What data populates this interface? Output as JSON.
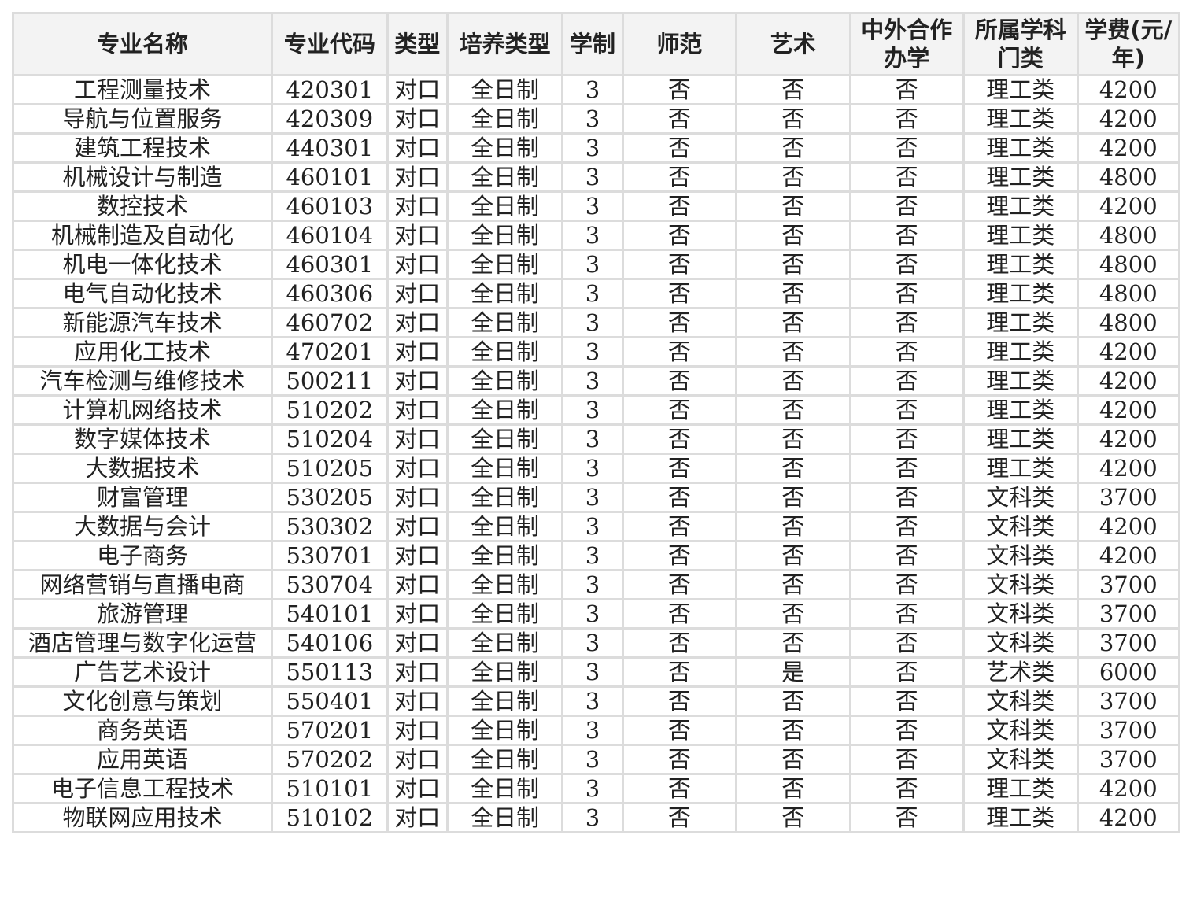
{
  "table": {
    "headers": [
      "专业名称",
      "专业代码",
      "类型",
      "培养类型",
      "学制",
      "师范",
      "艺术",
      "中外合作办学",
      "所属学科门类",
      "学费(元/年)"
    ],
    "rows": [
      [
        "工程测量技术",
        "420301",
        "对口",
        "全日制",
        "3",
        "否",
        "否",
        "否",
        "理工类",
        "4200"
      ],
      [
        "导航与位置服务",
        "420309",
        "对口",
        "全日制",
        "3",
        "否",
        "否",
        "否",
        "理工类",
        "4200"
      ],
      [
        "建筑工程技术",
        "440301",
        "对口",
        "全日制",
        "3",
        "否",
        "否",
        "否",
        "理工类",
        "4200"
      ],
      [
        "机械设计与制造",
        "460101",
        "对口",
        "全日制",
        "3",
        "否",
        "否",
        "否",
        "理工类",
        "4800"
      ],
      [
        "数控技术",
        "460103",
        "对口",
        "全日制",
        "3",
        "否",
        "否",
        "否",
        "理工类",
        "4200"
      ],
      [
        "机械制造及自动化",
        "460104",
        "对口",
        "全日制",
        "3",
        "否",
        "否",
        "否",
        "理工类",
        "4800"
      ],
      [
        "机电一体化技术",
        "460301",
        "对口",
        "全日制",
        "3",
        "否",
        "否",
        "否",
        "理工类",
        "4800"
      ],
      [
        "电气自动化技术",
        "460306",
        "对口",
        "全日制",
        "3",
        "否",
        "否",
        "否",
        "理工类",
        "4800"
      ],
      [
        "新能源汽车技术",
        "460702",
        "对口",
        "全日制",
        "3",
        "否",
        "否",
        "否",
        "理工类",
        "4800"
      ],
      [
        "应用化工技术",
        "470201",
        "对口",
        "全日制",
        "3",
        "否",
        "否",
        "否",
        "理工类",
        "4200"
      ],
      [
        "汽车检测与维修技术",
        "500211",
        "对口",
        "全日制",
        "3",
        "否",
        "否",
        "否",
        "理工类",
        "4200"
      ],
      [
        "计算机网络技术",
        "510202",
        "对口",
        "全日制",
        "3",
        "否",
        "否",
        "否",
        "理工类",
        "4200"
      ],
      [
        "数字媒体技术",
        "510204",
        "对口",
        "全日制",
        "3",
        "否",
        "否",
        "否",
        "理工类",
        "4200"
      ],
      [
        "大数据技术",
        "510205",
        "对口",
        "全日制",
        "3",
        "否",
        "否",
        "否",
        "理工类",
        "4200"
      ],
      [
        "财富管理",
        "530205",
        "对口",
        "全日制",
        "3",
        "否",
        "否",
        "否",
        "文科类",
        "3700"
      ],
      [
        "大数据与会计",
        "530302",
        "对口",
        "全日制",
        "3",
        "否",
        "否",
        "否",
        "文科类",
        "4200"
      ],
      [
        "电子商务",
        "530701",
        "对口",
        "全日制",
        "3",
        "否",
        "否",
        "否",
        "文科类",
        "4200"
      ],
      [
        "网络营销与直播电商",
        "530704",
        "对口",
        "全日制",
        "3",
        "否",
        "否",
        "否",
        "文科类",
        "3700"
      ],
      [
        "旅游管理",
        "540101",
        "对口",
        "全日制",
        "3",
        "否",
        "否",
        "否",
        "文科类",
        "3700"
      ],
      [
        "酒店管理与数字化运营",
        "540106",
        "对口",
        "全日制",
        "3",
        "否",
        "否",
        "否",
        "文科类",
        "3700"
      ],
      [
        "广告艺术设计",
        "550113",
        "对口",
        "全日制",
        "3",
        "否",
        "是",
        "否",
        "艺术类",
        "6000"
      ],
      [
        "文化创意与策划",
        "550401",
        "对口",
        "全日制",
        "3",
        "否",
        "否",
        "否",
        "文科类",
        "3700"
      ],
      [
        "商务英语",
        "570201",
        "对口",
        "全日制",
        "3",
        "否",
        "否",
        "否",
        "文科类",
        "3700"
      ],
      [
        "应用英语",
        "570202",
        "对口",
        "全日制",
        "3",
        "否",
        "否",
        "否",
        "文科类",
        "3700"
      ],
      [
        "电子信息工程技术",
        "510101",
        "对口",
        "全日制",
        "3",
        "否",
        "否",
        "否",
        "理工类",
        "4200"
      ],
      [
        "物联网应用技术",
        "510102",
        "对口",
        "全日制",
        "3",
        "否",
        "否",
        "否",
        "理工类",
        "4200"
      ]
    ]
  }
}
